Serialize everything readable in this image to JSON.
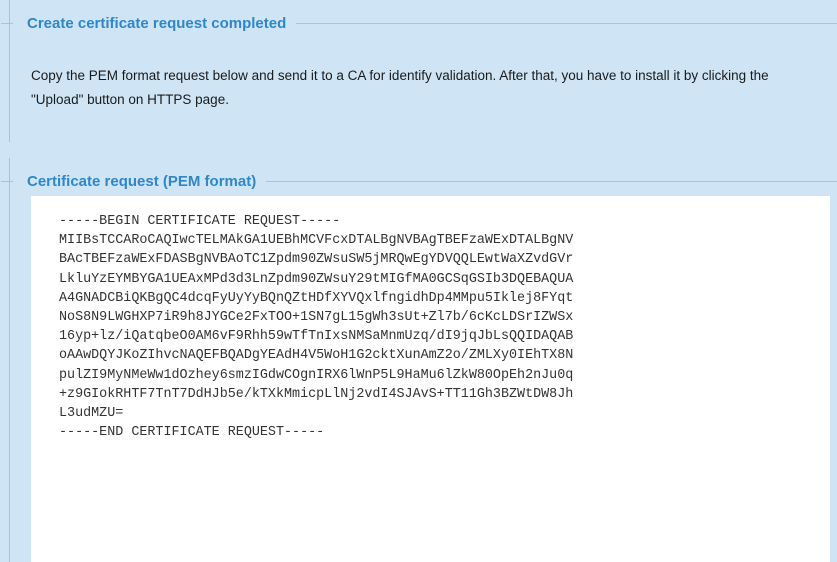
{
  "completed_section": {
    "legend": "Create certificate request completed",
    "description": "Copy the PEM format request below and send it to a CA for identify validation. After that, you have to install it by clicking the \"Upload\" button on HTTPS page."
  },
  "pem_section": {
    "legend": "Certificate request (PEM format)",
    "pem_text": "-----BEGIN CERTIFICATE REQUEST-----\nMIIBsTCCARoCAQIwcTELMAkGA1UEBhMCVFcxDTALBgNVBAgTBEFzaWExDTALBgNV\nBAcTBEFzaWExFDASBgNVBAoTC1Zpdm90ZWsuSW5jMRQwEgYDVQQLEwtWaXZvdGVr\nLkluYzEYMBYGA1UEAxMPd3d3LnZpdm90ZWsuY29tMIGfMA0GCSqGSIb3DQEBAQUA\nA4GNADCBiQKBgQC4dcqFyUyYyBQnQZtHDfXYVQxlfngidhDp4MMpu5Iklej8FYqt\nNoS8N9LWGHXP7iR9h8JYGCe2FxTOO+1SN7gL15gWh3sUt+Zl7b/6cKcLDSrIZWSx\n16yp+lz/iQatqbeO0AM6vF9Rhh59wTfTnIxsNMSaMnmUzq/dI9jqJbLsQQIDAQAB\noAAwDQYJKoZIhvcNAQEFBQADgYEAdH4V5WoH1G2cktXunAmZ2o/ZMLXy0IEhTX8N\npulZI9MyNMeWw1dOzhey6smzIGdwCOgnIRX6lWnP5L9HaMu6lZkW80OpEh2nJu0q\n+z9GIokRHTF7TnT7DdHJb5e/kTXkMmicpLlNj2vdI4SJAvS+TT11Gh3BZWtDW8Jh\nL3udMZU=\n-----END CERTIFICATE REQUEST-----"
  }
}
